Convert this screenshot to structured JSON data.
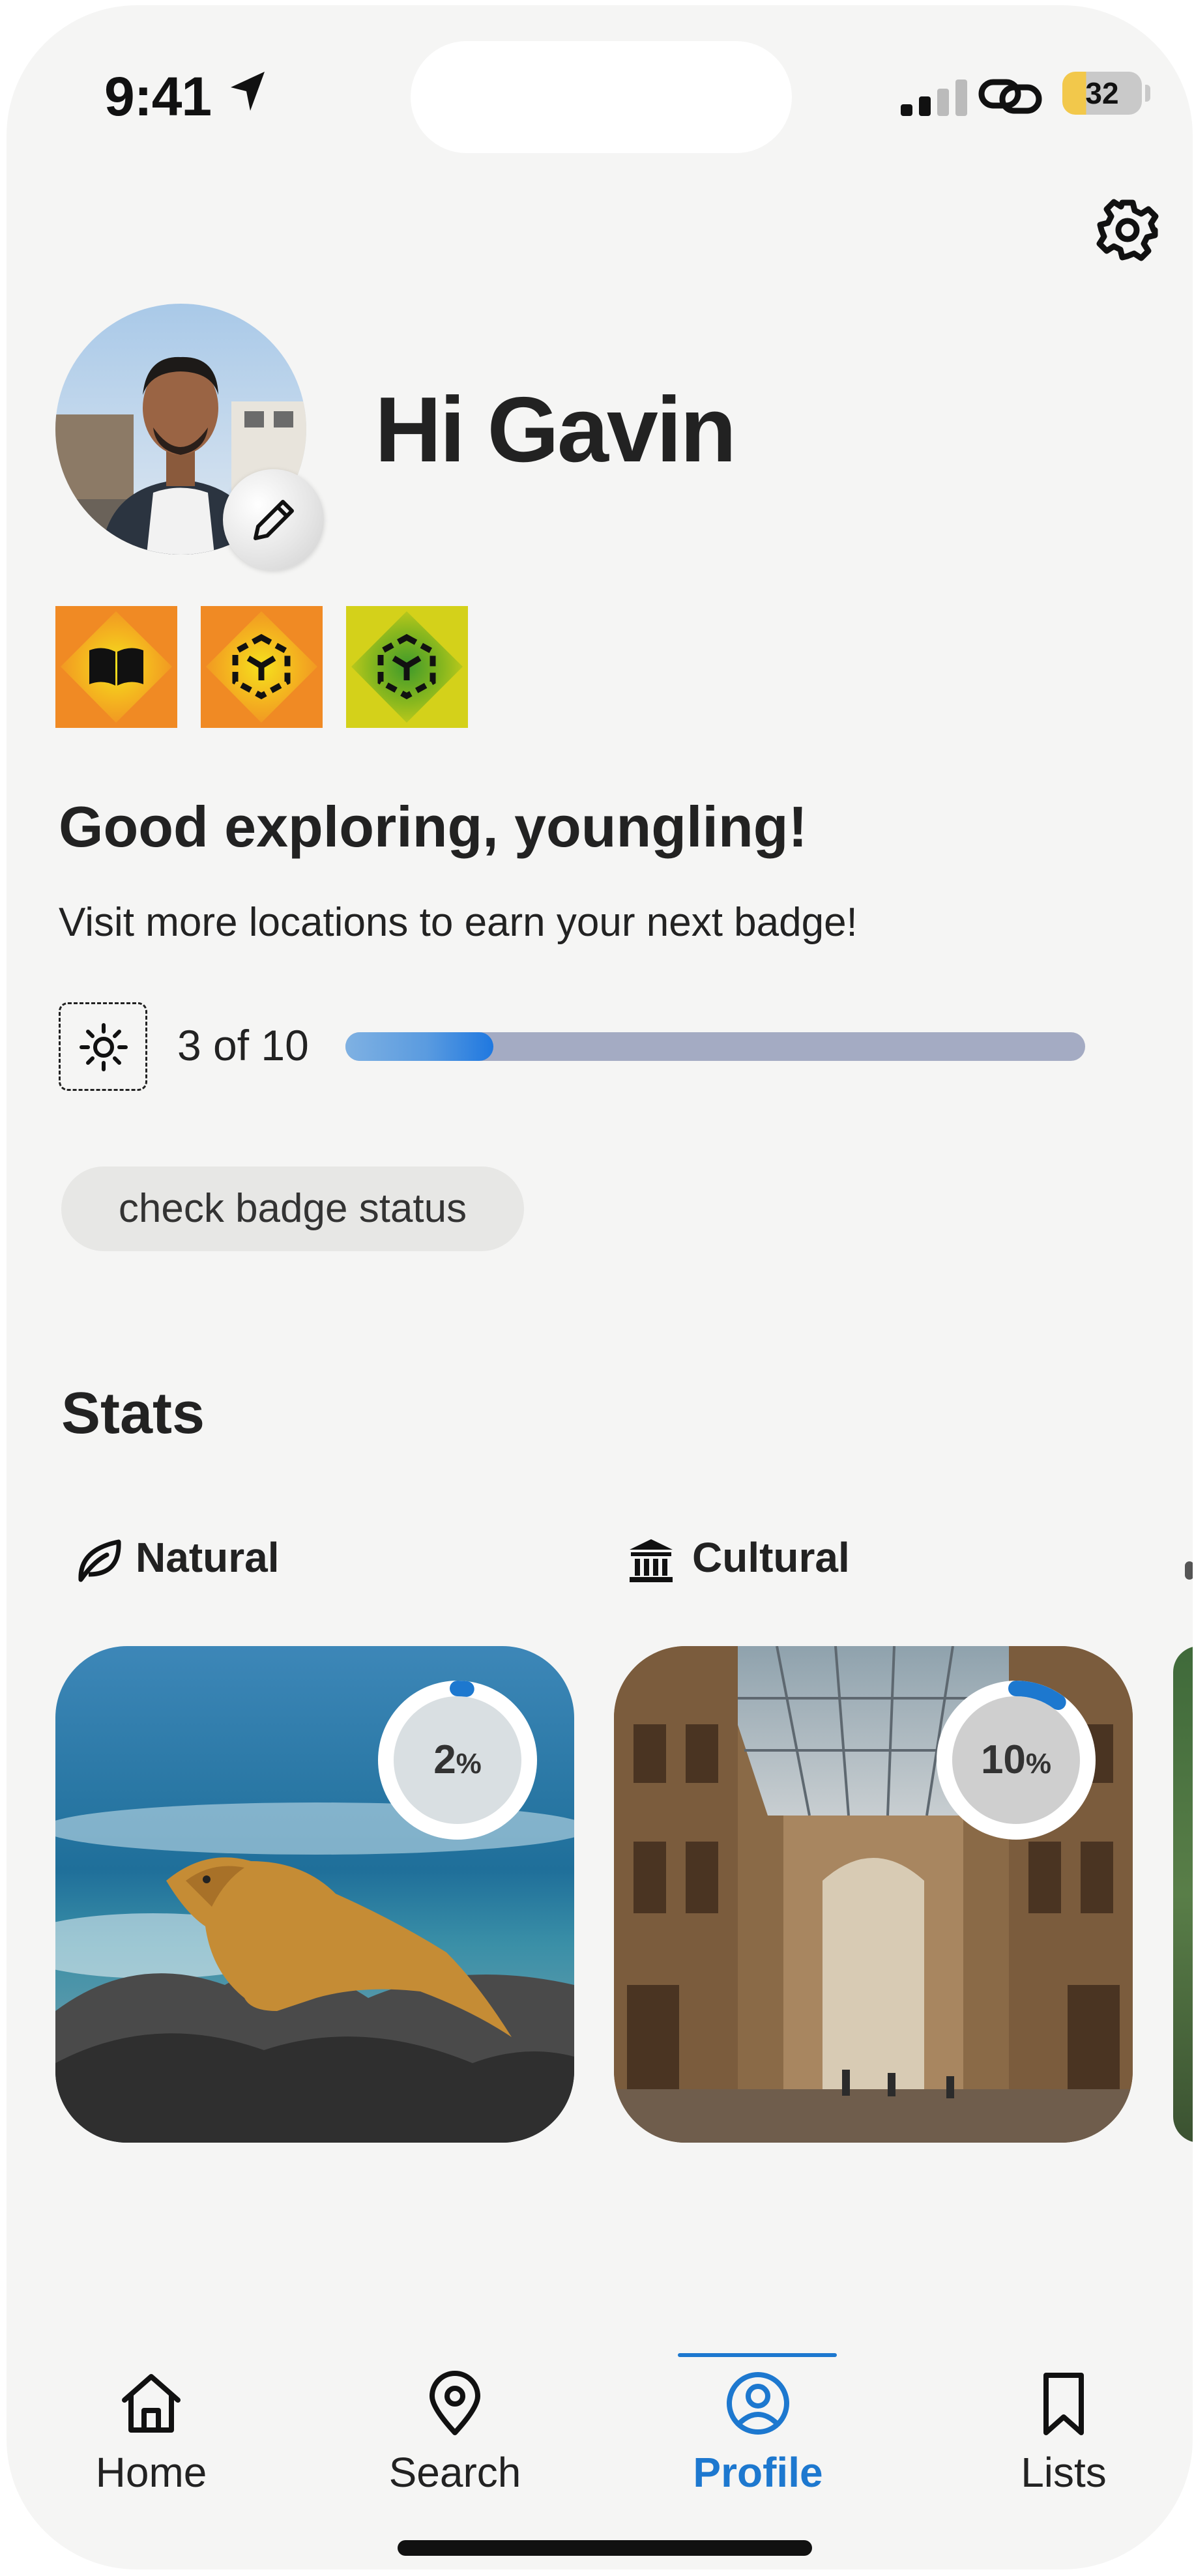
{
  "status_bar": {
    "time": "9:41",
    "battery": "32",
    "icons": [
      "location-arrow-icon",
      "cellular-signal-icon",
      "link-icon",
      "battery-icon"
    ]
  },
  "header": {
    "settings_icon": "gear-icon"
  },
  "profile": {
    "greeting": "Hi Gavin",
    "edit_icon": "pencil-icon"
  },
  "badges": [
    {
      "icon": "book-badge-icon",
      "color": "#f08a24"
    },
    {
      "icon": "cube-badge-icon",
      "color": "#f08a24"
    },
    {
      "icon": "cube-badge-icon",
      "color": "#d4d11a"
    }
  ],
  "achievement": {
    "headline": "Good exploring, youngling!",
    "subtext": "Visit more locations to earn your next badge!",
    "progress_icon": "sun-icon",
    "progress_text": "3 of 10",
    "progress_fraction": 0.2,
    "button_label": "check badge status"
  },
  "stats": {
    "title": "Stats",
    "categories": [
      {
        "label": "Natural",
        "icon": "leaf-icon",
        "percent": "2",
        "percent_value": 2,
        "unit": "%"
      },
      {
        "label": "Cultural",
        "icon": "museum-icon",
        "percent": "10",
        "percent_value": 10,
        "unit": "%"
      }
    ]
  },
  "tabbar": {
    "items": [
      {
        "label": "Home",
        "icon": "home-icon"
      },
      {
        "label": "Search",
        "icon": "map-pin-icon"
      },
      {
        "label": "Profile",
        "icon": "profile-icon",
        "active": true
      },
      {
        "label": "Lists",
        "icon": "bookmark-icon"
      }
    ]
  },
  "colors": {
    "accent": "#1d78cf",
    "progress_track": "#a4abc3",
    "background": "#f5f5f4"
  }
}
